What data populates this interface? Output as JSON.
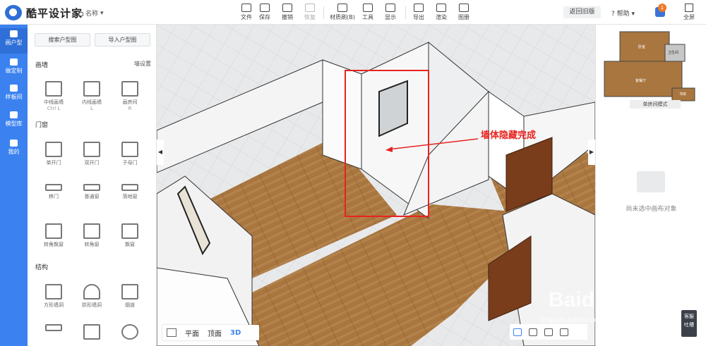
{
  "app": {
    "logo_text": "酷平设计家",
    "project_name": "名称"
  },
  "toolbar": [
    {
      "label": "文件",
      "icon": "file-icon",
      "disabled": false
    },
    {
      "label": "保存",
      "icon": "save-icon",
      "disabled": false
    },
    {
      "label": "撤销",
      "icon": "undo-icon",
      "disabled": false
    },
    {
      "label": "恢复",
      "icon": "redo-icon",
      "disabled": true
    },
    {
      "label": "材质刷(B)",
      "icon": "brush-icon",
      "disabled": false
    },
    {
      "label": "工具",
      "icon": "ruler-icon",
      "disabled": false
    },
    {
      "label": "显示",
      "icon": "eye-icon",
      "disabled": false
    },
    {
      "label": "导出",
      "icon": "export-icon",
      "disabled": false
    },
    {
      "label": "渲染",
      "icon": "teapot-icon",
      "disabled": false
    },
    {
      "label": "图册",
      "icon": "album-icon",
      "disabled": false
    }
  ],
  "header_right": {
    "old_version": "返回旧版",
    "help": "帮助",
    "notifications": "1",
    "fullscreen": "全屏"
  },
  "leftnav": [
    {
      "label": "画户型",
      "icon": "floorplan-icon",
      "active": true
    },
    {
      "label": "做定制",
      "icon": "tools-icon",
      "active": false
    },
    {
      "label": "样板间",
      "icon": "house-icon",
      "active": false
    },
    {
      "label": "模型库",
      "icon": "cube-icon",
      "active": false
    },
    {
      "label": "我的",
      "icon": "user-icon",
      "active": false
    }
  ],
  "panel": {
    "search_plan": "搜索户型图",
    "import_plan": "导入户型图",
    "wall_title": "画墙",
    "wall_settings": "墙设置",
    "walls": [
      {
        "label": "中线画墙",
        "shortcut": "Ctrl L"
      },
      {
        "label": "内线画墙",
        "shortcut": "L"
      },
      {
        "label": "画房间",
        "shortcut": "R"
      }
    ],
    "doors_title": "门窗",
    "doors": [
      "单开门",
      "双开门",
      "子母门",
      "移门",
      "普通窗",
      "落地窗",
      "转角飘窗",
      "转角窗",
      "飘窗"
    ],
    "structure_title": "结构",
    "structures": [
      "方形墙洞",
      "拱形墙洞",
      "烟道"
    ]
  },
  "viewport": {
    "view_tabs": [
      "平面",
      "顶面",
      "3D"
    ],
    "active_tab": "3D",
    "annotation": "墙体隐藏完成",
    "watermark": "Baidu经验",
    "watermark_url": "jingyan.baidu.com"
  },
  "right_panel": {
    "rooms": [
      "卧室",
      "卫生间",
      "客餐厅",
      "书房"
    ],
    "mode_label": "单房间模式",
    "empty_text": "尚未选中画布对象"
  },
  "customer_service": [
    "客服",
    "吐槽"
  ],
  "colors": {
    "accent": "#3b82f0",
    "annotation": "#e8231f",
    "floor": "#a9763f"
  }
}
